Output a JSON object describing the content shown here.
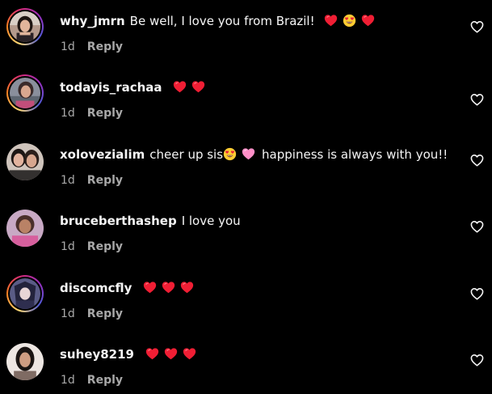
{
  "colors": {
    "background": "#000000",
    "primary_text": "#f5f5f5",
    "secondary_text": "#a8a8a8",
    "heart_red": "#ff2a3d"
  },
  "comments": [
    {
      "username": "why_jmrn",
      "text": "Be well, I love you from Brazil!",
      "time": "1d",
      "reply_label": "Reply",
      "story_ring": true,
      "emojis_after": [
        "red-heart",
        "heart-eyes",
        "red-heart"
      ]
    },
    {
      "username": "todayis_rachaa",
      "text": "",
      "time": "1d",
      "reply_label": "Reply",
      "story_ring": true,
      "emojis_after": [
        "red-heart",
        "red-heart"
      ]
    },
    {
      "username": "xolovezialim",
      "text": "cheer up sis",
      "text2": "happiness is always with you!!",
      "time": "1d",
      "reply_label": "Reply",
      "story_ring": false,
      "emojis_mid": [
        "heart-eyes",
        "pink-heart"
      ]
    },
    {
      "username": "bruceberthashep",
      "text": "I love you",
      "time": "1d",
      "reply_label": "Reply",
      "story_ring": false
    },
    {
      "username": "discomcfly",
      "text": "",
      "time": "1d",
      "reply_label": "Reply",
      "story_ring": true,
      "emojis_after": [
        "red-heart",
        "red-heart",
        "red-heart"
      ]
    },
    {
      "username": "suhey8219",
      "text": "",
      "time": "1d",
      "reply_label": "Reply",
      "story_ring": false,
      "emojis_after": [
        "red-heart",
        "red-heart",
        "red-heart"
      ]
    }
  ]
}
